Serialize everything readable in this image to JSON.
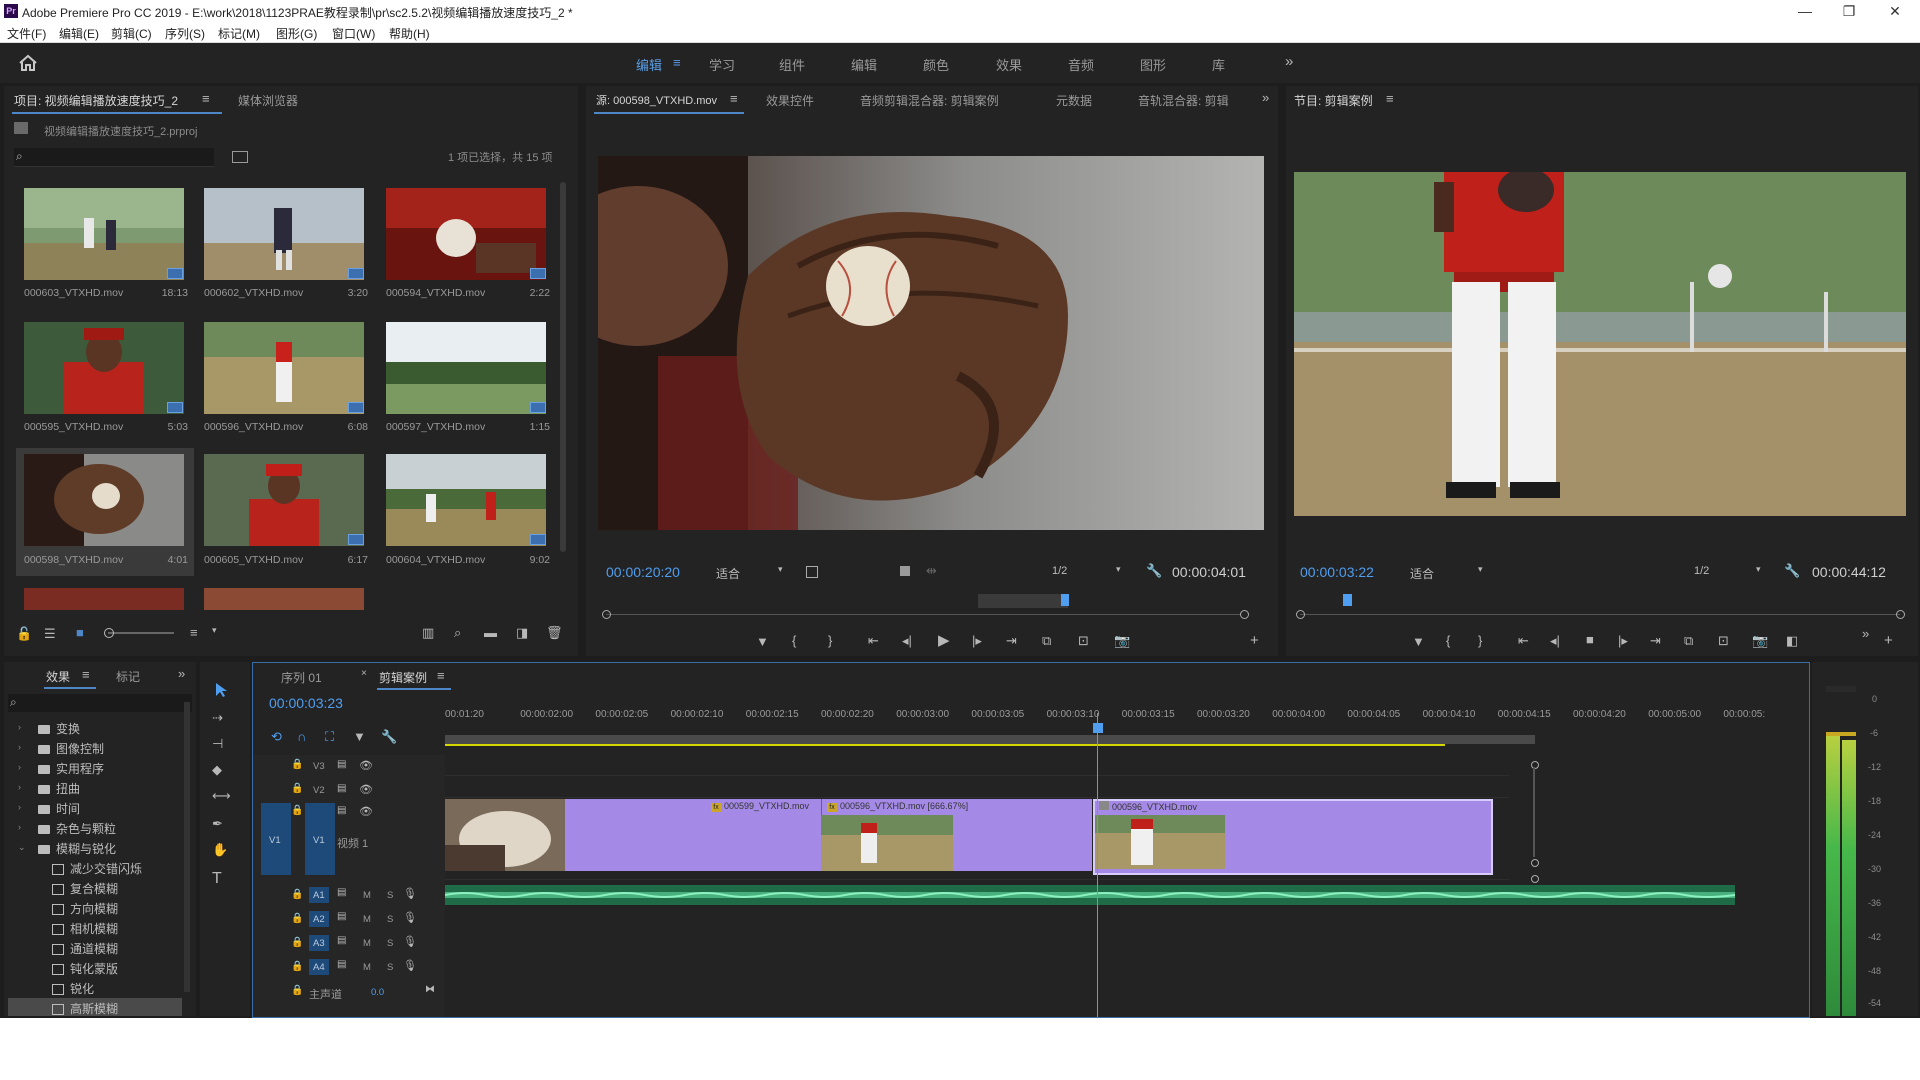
{
  "app": {
    "title": "Adobe Premiere Pro CC 2019 - E:\\work\\2018\\1123PRAE教程录制\\pr\\sc2.5.2\\视频编辑播放速度技巧_2 *",
    "icon_label": "Pr",
    "window_controls": [
      "—",
      "❐",
      "✕"
    ]
  },
  "menu": [
    "文件(F)",
    "编辑(E)",
    "剪辑(C)",
    "序列(S)",
    "标记(M)",
    "图形(G)",
    "窗口(W)",
    "帮助(H)"
  ],
  "workspaces": {
    "items": [
      "编辑",
      "学习",
      "组件",
      "编辑",
      "颜色",
      "效果",
      "音频",
      "图形",
      "库"
    ],
    "active_index": 0,
    "first_label": "编辑",
    "active_accent": "#5a9de8"
  },
  "project": {
    "tab_label": "项目: 视频编辑播放速度技巧_2",
    "tab2_label": "媒体浏览器",
    "file_name": "视频编辑播放速度技巧_2.prproj",
    "search_placeholder": "",
    "selection_info": "1 项已选择，共 15 项",
    "clips": [
      {
        "name": "000603_VTXHD.mov",
        "dur": "18:13"
      },
      {
        "name": "000602_VTXHD.mov",
        "dur": "3:20"
      },
      {
        "name": "000594_VTXHD.mov",
        "dur": "2:22"
      },
      {
        "name": "000595_VTXHD.mov",
        "dur": "5:03"
      },
      {
        "name": "000596_VTXHD.mov",
        "dur": "6:08"
      },
      {
        "name": "000597_VTXHD.mov",
        "dur": "1:15"
      },
      {
        "name": "000598_VTXHD.mov",
        "dur": "4:01"
      },
      {
        "name": "000605_VTXHD.mov",
        "dur": "6:17"
      },
      {
        "name": "000604_VTXHD.mov",
        "dur": "9:02"
      }
    ]
  },
  "source": {
    "tabs": [
      "源: 000598_VTXHD.mov",
      "效果控件",
      "音频剪辑混合器: 剪辑案例",
      "元数据",
      "音轨混合器: 剪辑"
    ],
    "timecode": "00:00:20:20",
    "fit": "适合",
    "resolution": "1/2",
    "duration": "00:00:04:01"
  },
  "program": {
    "tab_label": "节目: 剪辑案例",
    "timecode": "00:00:03:22",
    "fit": "适合",
    "resolution": "1/2",
    "duration": "00:00:44:12"
  },
  "effects": {
    "tabs": [
      "效果",
      "标记"
    ],
    "folders": [
      "变换",
      "图像控制",
      "实用程序",
      "扭曲",
      "时间",
      "杂色与颗粒",
      "模糊与锐化"
    ],
    "items": [
      "减少交错闪烁",
      "复合模糊",
      "方向模糊",
      "相机模糊",
      "通道模糊",
      "钝化蒙版",
      "锐化",
      "高斯模糊"
    ]
  },
  "timeline": {
    "tabs": [
      "序列 01",
      "剪辑案例"
    ],
    "timecode": "00:00:03:23",
    "ruler": [
      "00:01:20",
      "00:00:02:00",
      "00:00:02:05",
      "00:00:02:10",
      "00:00:02:15",
      "00:00:02:20",
      "00:00:03:00",
      "00:00:03:05",
      "00:00:03:10",
      "00:00:03:15",
      "00:00:03:20",
      "00:00:04:00",
      "00:00:04:05",
      "00:00:04:10",
      "00:00:04:15",
      "00:00:04:20",
      "00:00:05:00",
      "00:00:05:"
    ],
    "video_tracks": [
      "V3",
      "V2",
      "V1"
    ],
    "v1_name": "视频 1",
    "audio_tracks": [
      "A1",
      "A2",
      "A3",
      "A4"
    ],
    "master_label": "主声道",
    "master_value": "0.0",
    "clips": [
      {
        "name": "000599_VTXHD.mov"
      },
      {
        "name": "000596_VTXHD.mov [666.67%]"
      },
      {
        "name": "000596_VTXHD.mov"
      }
    ],
    "track_letters": {
      "m": "M",
      "s": "S"
    }
  },
  "meter": {
    "labels": [
      "0",
      "-6",
      "-12",
      "-18",
      "-24",
      "-30",
      "-36",
      "-42",
      "-48",
      "-54"
    ]
  },
  "colors": {
    "clip_purple": "#a48ae6",
    "audio_green": "#2f9e6a",
    "accent_blue": "#4f9ef0"
  }
}
